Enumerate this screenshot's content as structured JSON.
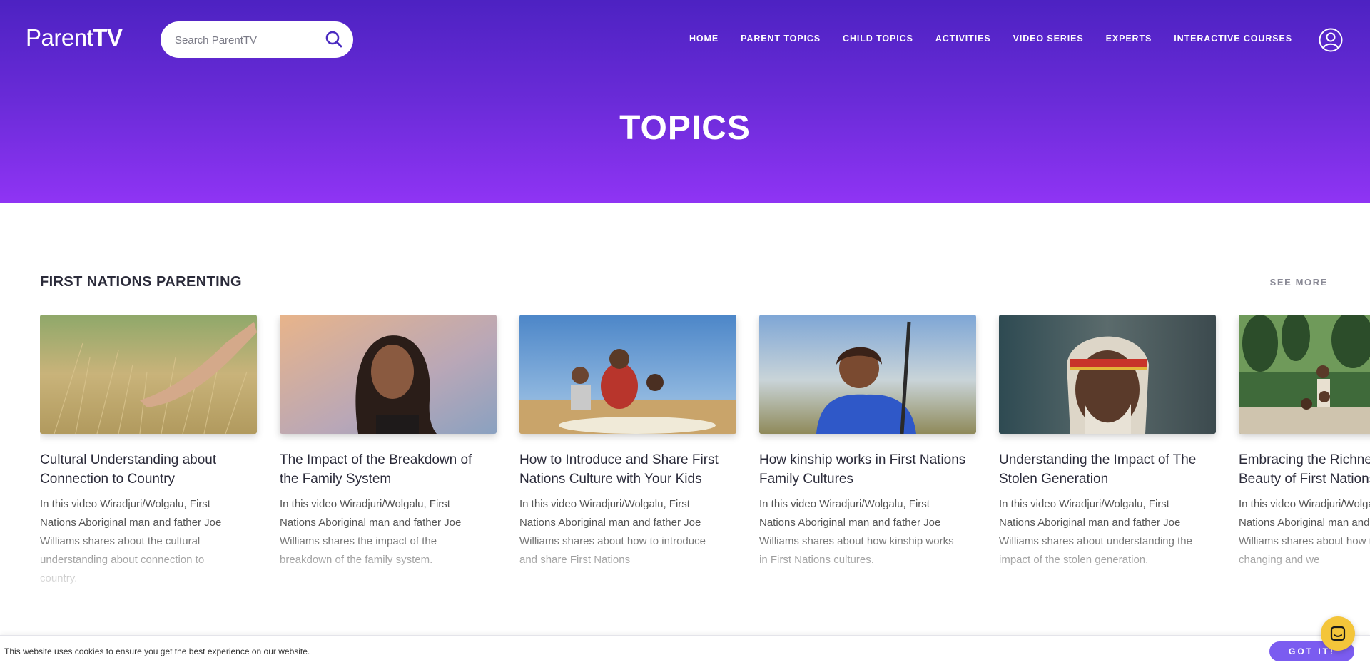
{
  "header": {
    "logo_light": "Parent",
    "logo_bold": "TV",
    "search_placeholder": "Search ParentTV",
    "nav": [
      "HOME",
      "PARENT TOPICS",
      "CHILD TOPICS",
      "ACTIVITIES",
      "VIDEO SERIES",
      "EXPERTS",
      "INTERACTIVE COURSES"
    ]
  },
  "hero": {
    "title": "TOPICS"
  },
  "section": {
    "title": "FIRST NATIONS PARENTING",
    "see_more": "SEE MORE",
    "cards": [
      {
        "title": "Cultural Understanding about Connection to Country",
        "description": "In this video Wiradjuri/Wolgalu, First Nations Aboriginal man and father Joe Williams shares about the cultural understanding about connection to country."
      },
      {
        "title": "The Impact of the Breakdown of the Family System",
        "description": "In this video Wiradjuri/Wolgalu, First Nations Aboriginal man and father Joe Williams shares the impact of the breakdown of the family system."
      },
      {
        "title": "How to Introduce and Share First Nations Culture with Your Kids",
        "description": "In this video Wiradjuri/Wolgalu, First Nations Aboriginal man and father Joe Williams shares about how to introduce and share First Nations"
      },
      {
        "title": "How kinship works in First Nations Family Cultures",
        "description": "In this video Wiradjuri/Wolgalu, First Nations Aboriginal man and father Joe Williams shares about how kinship works in First Nations cultures."
      },
      {
        "title": "Understanding the Impact of The Stolen Generation",
        "description": "In this video Wiradjuri/Wolgalu, First Nations Aboriginal man and father Joe Williams shares about understanding the impact of the stolen generation."
      },
      {
        "title": "Embracing the Richness and Beauty of First Nations Culture",
        "description": "In this video Wiradjuri/Wolgalu, First Nations Aboriginal man and father Joe Williams shares about how times are changing and we"
      }
    ]
  },
  "cookie": {
    "text": "This website uses cookies to ensure you get the best experience on our website.",
    "button": "GOT IT!"
  },
  "icons": {
    "search": "search-icon",
    "user": "user-icon",
    "chat": "chat-icon"
  },
  "colors": {
    "hero_top": "#4d22c2",
    "hero_bottom": "#8f34f4",
    "accent": "#7b5cf0",
    "chat": "#f4c53a"
  }
}
